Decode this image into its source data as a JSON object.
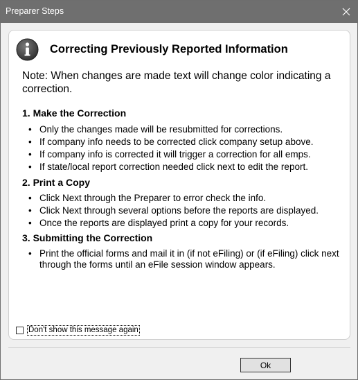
{
  "window": {
    "title": "Preparer Steps"
  },
  "dialog": {
    "heading": "Correcting Previously Reported Information",
    "note": "Note: When changes are made text will change color indicating a correction.",
    "sections": [
      {
        "title": "1. Make the Correction",
        "items": [
          "Only the changes made will be resubmitted for corrections.",
          "If company info needs to be corrected click company setup above.",
          "If company info is corrected it will trigger a correction for all emps.",
          "If state/local report correction needed click next to edit the report."
        ]
      },
      {
        "title": "2. Print a Copy",
        "items": [
          "Click Next through the Preparer to error check the info.",
          "Click Next through several options before the reports are displayed.",
          "Once the reports are displayed print a copy for your records."
        ]
      },
      {
        "title": "3. Submitting the Correction",
        "items": [
          "Print the official forms and mail it in (if not eFiling) or (if eFiling) click next through the forms until an eFile session window appears."
        ]
      }
    ],
    "dont_show": {
      "label": "Don't show this message again",
      "checked": false
    },
    "ok_label": "Ok"
  },
  "icons": {
    "info": "info-icon",
    "close": "close-icon"
  }
}
